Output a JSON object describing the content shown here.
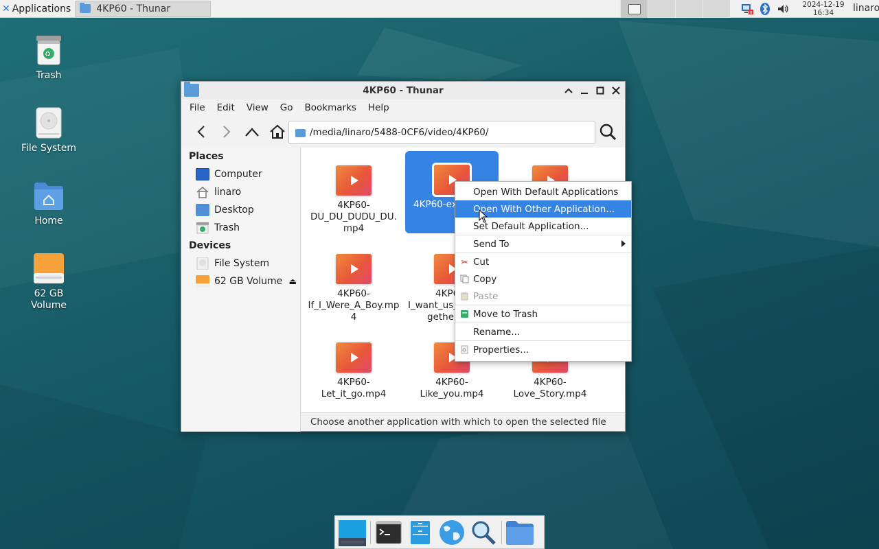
{
  "panel": {
    "applications_label": "Applications",
    "task_title": "4KP60 - Thunar",
    "clock_date": "2024-12-19",
    "clock_time": "16:34",
    "user": "linaro"
  },
  "desktop": {
    "icons": [
      {
        "label": "Trash"
      },
      {
        "label": "File System"
      },
      {
        "label": "Home"
      },
      {
        "label": "62 GB Volume"
      }
    ]
  },
  "window": {
    "title": "4KP60 - Thunar",
    "menu": [
      "File",
      "Edit",
      "View",
      "Go",
      "Bookmarks",
      "Help"
    ],
    "location": "/media/linaro/5488-0CF6/video/4KP60/",
    "sidebar": {
      "places_heading": "Places",
      "places": [
        "Computer",
        "linaro",
        "Desktop",
        "Trash"
      ],
      "devices_heading": "Devices",
      "devices": [
        "File System",
        "62 GB Volume"
      ]
    },
    "files": [
      {
        "name_lines": [
          "4KP60-",
          "DU_DU_DUDU_DU.",
          "mp4"
        ]
      },
      {
        "name_lines": [
          "4KP60-ex"
        ]
      },
      {
        "name_lines": [
          ""
        ]
      },
      {
        "name_lines": [
          "4KP60-",
          "If_I_Were_A_Boy.mp",
          "4"
        ]
      },
      {
        "name_lines": [
          "4KP6",
          "I_want_us_",
          "gether"
        ]
      },
      {
        "name_lines": [
          ""
        ]
      },
      {
        "name_lines": [
          "4KP60-",
          "Let_it_go.mp4"
        ]
      },
      {
        "name_lines": [
          "4KP60-",
          "Like_you.mp4"
        ]
      },
      {
        "name_lines": [
          "4KP60-",
          "Love_Story.mp4"
        ]
      }
    ],
    "status": "Choose another application with which to open the selected file"
  },
  "context_menu": {
    "items": [
      "Open With Default Applications",
      "Open With Other Application...",
      "Set Default Application...",
      "Send To",
      "Cut",
      "Copy",
      "Paste",
      "Move to Trash",
      "Rename...",
      "Properties..."
    ]
  }
}
